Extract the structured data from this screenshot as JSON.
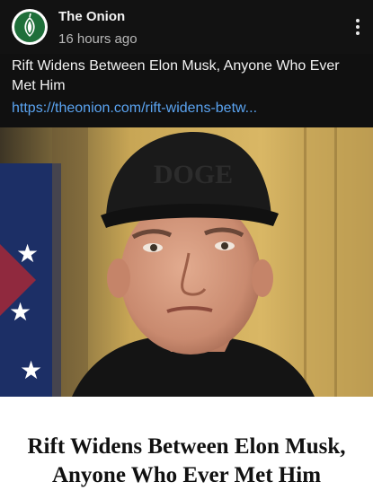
{
  "post": {
    "author": "The Onion",
    "timestamp": "16 hours ago",
    "text": "Rift Widens Between Elon Musk, Anyone Who Ever Met Him",
    "link": "https://theonion.com/rift-widens-betw..."
  },
  "photo": {
    "cap_text": "DOGE"
  },
  "article": {
    "headline": "Rift Widens Between Elon Musk, Anyone Who Ever Met Him"
  },
  "icons": {
    "avatar": "onion-logo-icon",
    "menu": "more-vertical-icon"
  },
  "colors": {
    "background": "#121212",
    "link": "#5aa3f0",
    "brand_green": "#1f6f3a",
    "headline_text": "#111111"
  }
}
